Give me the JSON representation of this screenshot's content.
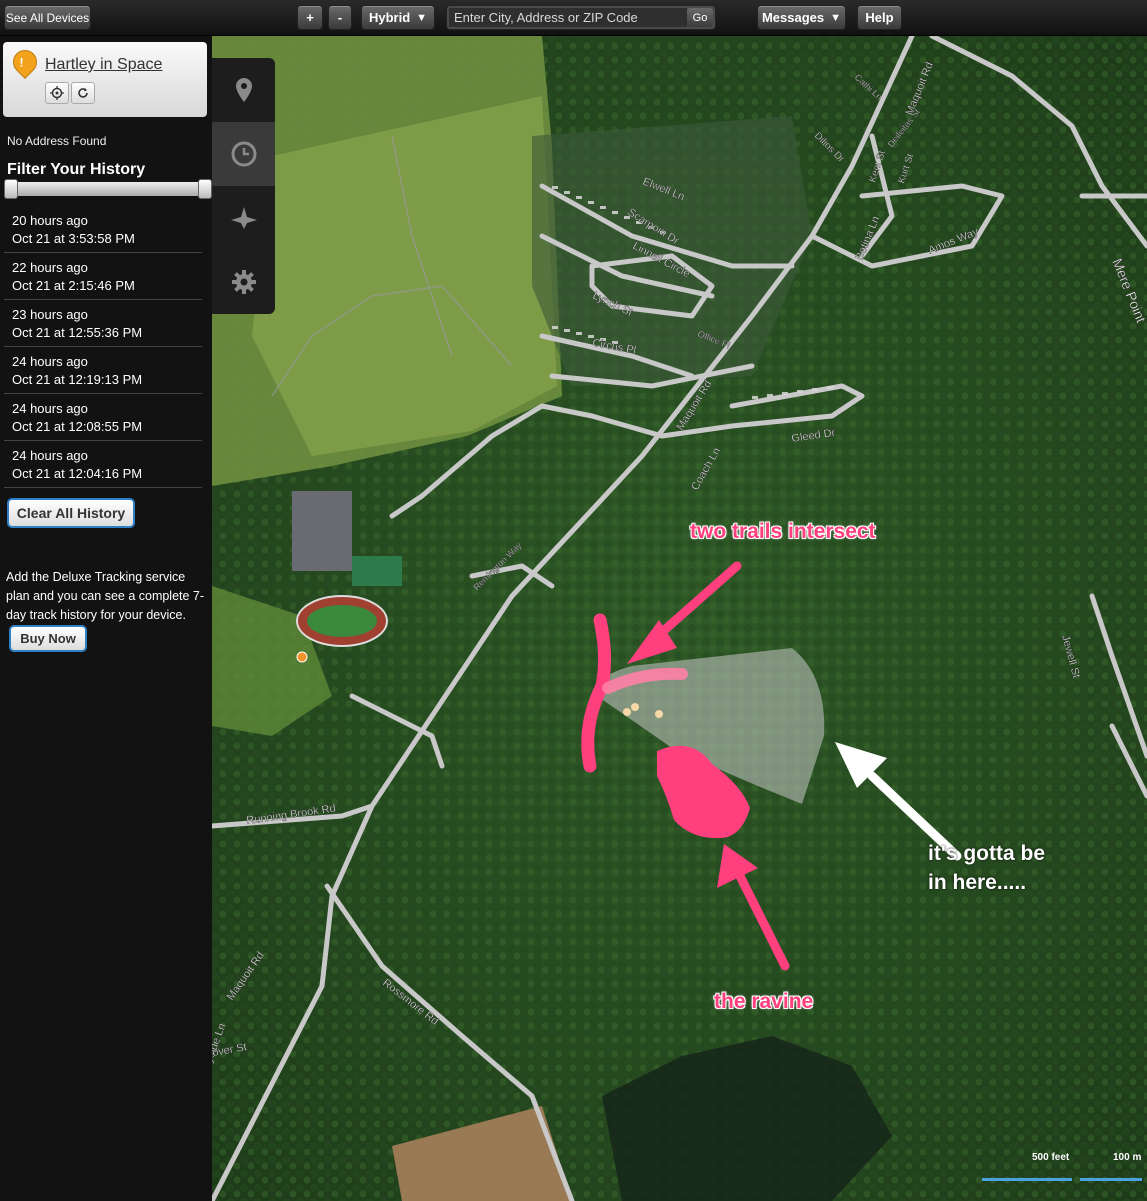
{
  "topbar": {
    "see_all_devices": "See All Devices",
    "zoom_in": "+",
    "zoom_out": "-",
    "map_type": "Hybrid",
    "search_placeholder": "Enter City, Address or ZIP Code",
    "go": "Go",
    "messages": "Messages",
    "help": "Help"
  },
  "device": {
    "name": "Hartley in Space",
    "pin_icon": "warning-pin-icon",
    "locate_icon": "crosshair-icon",
    "refresh_icon": "refresh-icon"
  },
  "sidebar": {
    "no_address": "No Address Found",
    "filter_title": "Filter Your History",
    "history": [
      {
        "ago": "20 hours ago",
        "date": "Oct 21 at 3:53:58 PM"
      },
      {
        "ago": "22 hours ago",
        "date": "Oct 21 at 2:15:46 PM"
      },
      {
        "ago": "23 hours ago",
        "date": "Oct 21 at 12:55:36 PM"
      },
      {
        "ago": "24 hours ago",
        "date": "Oct 21 at 12:19:13 PM"
      },
      {
        "ago": "24 hours ago",
        "date": "Oct 21 at 12:08:55 PM"
      },
      {
        "ago": "24 hours ago",
        "date": "Oct 21 at 12:04:16 PM"
      }
    ],
    "clear_button": "Clear All History",
    "promo_text": "Add the Deluxe Tracking service plan and you can see a complete 7-day track history for your device.",
    "buy_button": "Buy Now"
  },
  "toolstrip": {
    "icons": [
      "location-pin-icon",
      "clock-icon",
      "share-nodes-icon",
      "gear-icon"
    ],
    "active": "clock-icon"
  },
  "map": {
    "roads": {
      "maquoit_top": "Maquoit Rd",
      "maquoit_mid": "Maquoit Rd",
      "maquoit_bottom": "Maquoit Rd",
      "elwell": "Elwell Ln",
      "scarponi": "Scarponi Dr",
      "linnell": "Linnell Circle",
      "lynch": "Lynch St",
      "circus": "Circus Pl",
      "office": "Office Pl",
      "gleed": "Gleed Dr",
      "coach": "Coach Ln",
      "remington": "Remington Way",
      "running_brook": "Running Brook Rd",
      "rossmore": "Rossmore Rd",
      "amos": "Amos Way",
      "betina": "Betina Ln",
      "kent": "Kent St",
      "kurt": "Kurt St",
      "deifeitas": "Deifeitas St",
      "dilios": "Dilios Dr",
      "cathi": "Cathi Ln",
      "mere_point": "Mere Point",
      "jewell": "Jewell St",
      "bayside": "Bayside Ln",
      "glover": "Glover St"
    },
    "annotations": {
      "trails": "two trails intersect",
      "ravine": "the ravine",
      "here_line1": "it's gotta be",
      "here_line2": "in here....."
    },
    "scale": {
      "feet": "500 feet",
      "meters": "100 m"
    },
    "colors": {
      "annotation_pink": "#ff3f7e",
      "accuracy_zone": "#c9c9c9",
      "road": "#c8c8c8"
    }
  }
}
